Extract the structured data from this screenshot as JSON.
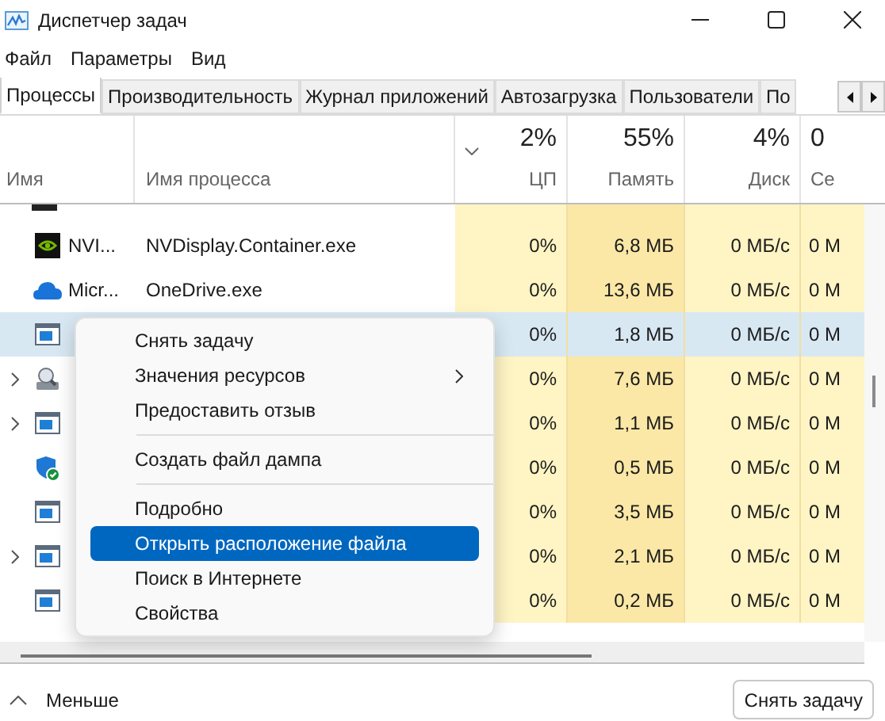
{
  "window": {
    "title": "Диспетчер задач"
  },
  "menu": [
    "Файл",
    "Параметры",
    "Вид"
  ],
  "tabs": [
    {
      "label": "Процессы",
      "selected": true
    },
    {
      "label": "Производительность",
      "selected": false
    },
    {
      "label": "Журнал приложений",
      "selected": false
    },
    {
      "label": "Автозагрузка",
      "selected": false
    },
    {
      "label": "Пользователи",
      "selected": false
    },
    {
      "label": "По",
      "selected": false
    }
  ],
  "columns": [
    {
      "label": "Имя"
    },
    {
      "label": "Имя процесса"
    },
    {
      "usage": "2%",
      "label": "ЦП"
    },
    {
      "usage": "55%",
      "label": "Память"
    },
    {
      "usage": "4%",
      "label": "Диск"
    },
    {
      "usage": "0",
      "label": "Се"
    }
  ],
  "rows": [
    {
      "kind": "nvidia",
      "expandable": false,
      "selected": false,
      "name": "NVI...",
      "process": "NVDisplay.Container.exe",
      "cpu": "0%",
      "memory": "6,8 МБ",
      "disk": "0 МБ/с",
      "network": "0 М"
    },
    {
      "kind": "cloud",
      "expandable": false,
      "selected": false,
      "name": "Micr...",
      "process": "OneDrive.exe",
      "cpu": "0%",
      "memory": "13,6 МБ",
      "disk": "0 МБ/с",
      "network": "0 М"
    },
    {
      "kind": "window",
      "expandable": false,
      "selected": true,
      "cpu": "0%",
      "memory": "1,8 МБ",
      "disk": "0 МБ/с",
      "network": "0 М"
    },
    {
      "kind": "user",
      "expandable": true,
      "selected": false,
      "cpu": "0%",
      "memory": "7,6 МБ",
      "disk": "0 МБ/с",
      "network": "0 М"
    },
    {
      "kind": "window",
      "expandable": true,
      "selected": false,
      "cpu": "0%",
      "memory": "1,1 МБ",
      "disk": "0 МБ/с",
      "network": "0 М"
    },
    {
      "kind": "shield",
      "expandable": false,
      "selected": false,
      "cpu": "0%",
      "memory": "0,5 МБ",
      "disk": "0 МБ/с",
      "network": "0 М"
    },
    {
      "kind": "window",
      "expandable": false,
      "selected": false,
      "cpu": "0%",
      "memory": "3,5 МБ",
      "disk": "0 МБ/с",
      "network": "0 М"
    },
    {
      "kind": "window",
      "expandable": true,
      "selected": false,
      "cpu": "0%",
      "memory": "2,1 МБ",
      "disk": "0 МБ/с",
      "network": "0 М"
    },
    {
      "kind": "window",
      "expandable": false,
      "selected": false,
      "cpu": "0%",
      "memory": "0,2 МБ",
      "disk": "0 МБ/с",
      "network": "0 М"
    }
  ],
  "context_menu": [
    {
      "kind": "item",
      "label": "Снять задачу",
      "selected": false,
      "submenu": false
    },
    {
      "kind": "item",
      "label": "Значения ресурсов",
      "selected": false,
      "submenu": true
    },
    {
      "kind": "item",
      "label": "Предоставить отзыв",
      "selected": false,
      "submenu": false
    },
    {
      "kind": "separator"
    },
    {
      "kind": "item",
      "label": "Создать файл дампа",
      "selected": false,
      "submenu": false
    },
    {
      "kind": "separator"
    },
    {
      "kind": "item",
      "label": "Подробно",
      "selected": false,
      "submenu": false
    },
    {
      "kind": "item",
      "label": "Открыть расположение файла",
      "selected": true,
      "submenu": false
    },
    {
      "kind": "item",
      "label": "Поиск в Интернете",
      "selected": false,
      "submenu": false
    },
    {
      "kind": "item",
      "label": "Свойства",
      "selected": false,
      "submenu": false
    }
  ],
  "footer": {
    "toggle": "Меньше",
    "end_task": "Снять задачу"
  }
}
